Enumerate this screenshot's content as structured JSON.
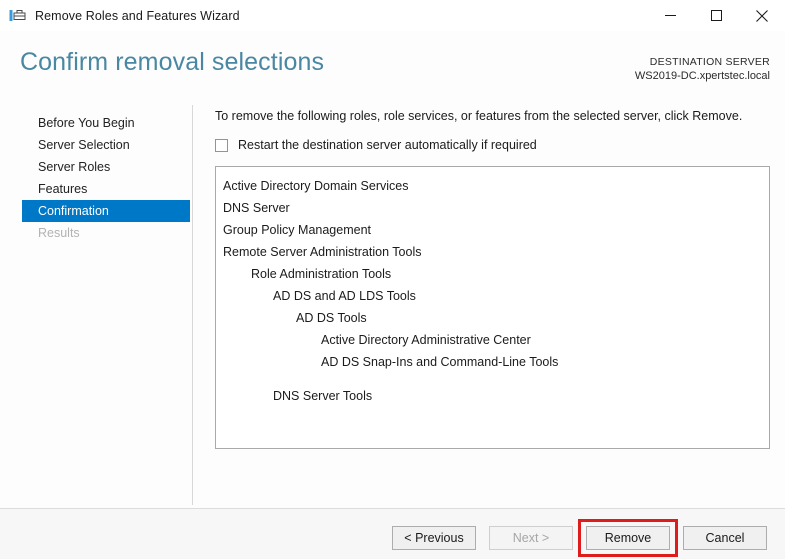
{
  "window": {
    "title": "Remove Roles and Features Wizard",
    "icon": "server-roles-icon",
    "controls": {
      "minimize": "minimize-icon",
      "maximize": "maximize-icon",
      "close": "close-icon"
    }
  },
  "header": {
    "page_title": "Confirm removal selections",
    "destination_label": "DESTINATION SERVER",
    "destination_server": "WS2019-DC.xpertstec.local"
  },
  "sidebar": {
    "items": [
      {
        "label": "Before You Begin",
        "state": "normal"
      },
      {
        "label": "Server Selection",
        "state": "normal"
      },
      {
        "label": "Server Roles",
        "state": "normal"
      },
      {
        "label": "Features",
        "state": "normal"
      },
      {
        "label": "Confirmation",
        "state": "selected"
      },
      {
        "label": "Results",
        "state": "disabled"
      }
    ]
  },
  "main": {
    "instruction": "To remove the following roles, role services, or features from the selected server, click Remove.",
    "restart_checkbox": {
      "label": "Restart the destination server automatically if required",
      "checked": false
    },
    "removal_list": [
      {
        "label": "Active Directory Domain Services",
        "level": 0,
        "gap_before": false
      },
      {
        "label": "DNS Server",
        "level": 0,
        "gap_before": false
      },
      {
        "label": "Group Policy Management",
        "level": 0,
        "gap_before": false
      },
      {
        "label": "Remote Server Administration Tools",
        "level": 0,
        "gap_before": false
      },
      {
        "label": "Role Administration Tools",
        "level": 1,
        "gap_before": false
      },
      {
        "label": "AD DS and AD LDS Tools",
        "level": 2,
        "gap_before": false
      },
      {
        "label": "AD DS Tools",
        "level": 3,
        "gap_before": false
      },
      {
        "label": "Active Directory Administrative Center",
        "level": 4,
        "gap_before": false
      },
      {
        "label": "AD DS Snap-Ins and Command-Line Tools",
        "level": 4,
        "gap_before": false
      },
      {
        "label": "DNS Server Tools",
        "level": 2,
        "gap_before": true
      }
    ]
  },
  "footer": {
    "previous_label": "< Previous",
    "next_label": "Next >",
    "remove_label": "Remove",
    "cancel_label": "Cancel",
    "next_disabled": true,
    "highlight_color": "#e01b1b"
  },
  "colors": {
    "accent_selected": "#0078c8",
    "heading": "#4a87a2",
    "annotation_red": "#e01b1b"
  }
}
